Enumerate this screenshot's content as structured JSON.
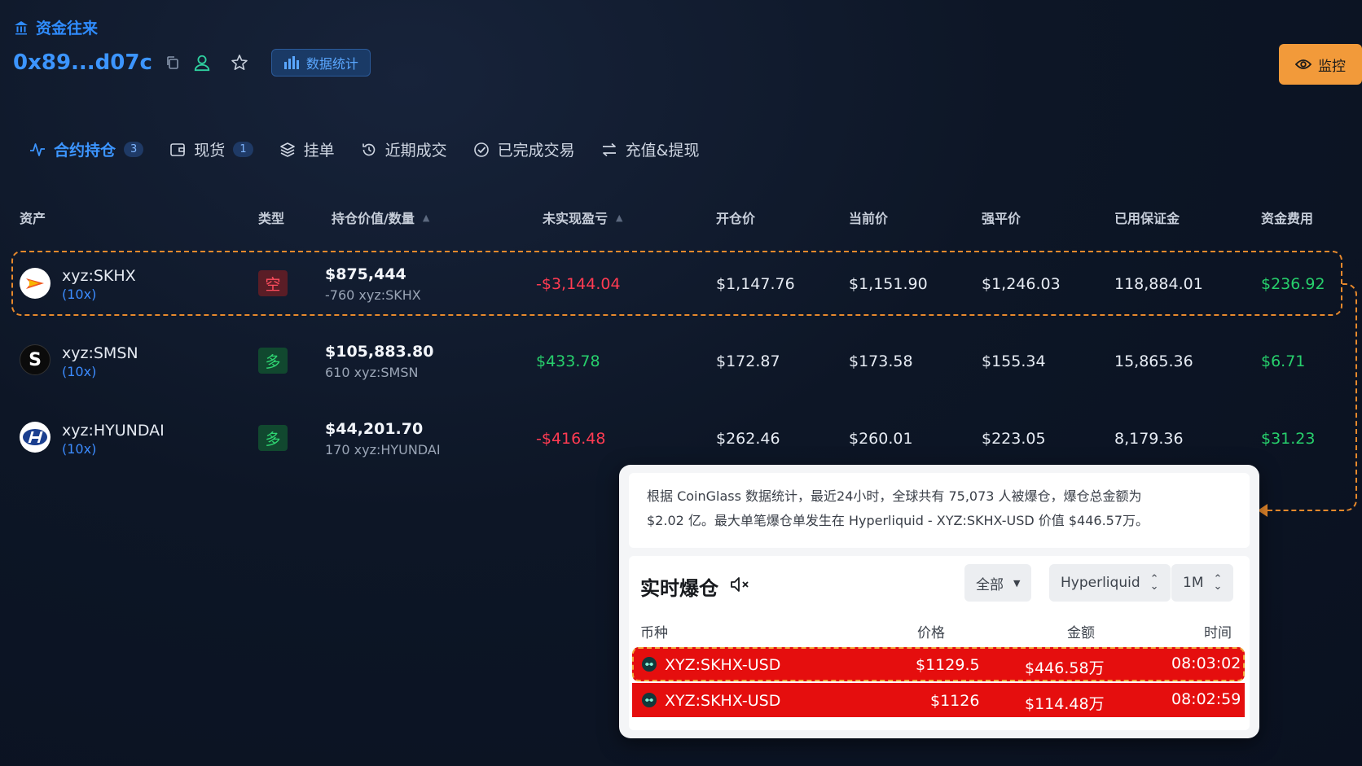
{
  "header": {
    "section_title": "资金往来",
    "address": "0x89...d07c",
    "stats_button": "数据统计",
    "monitor_button": "监控"
  },
  "tabs": [
    {
      "label": "合约持仓",
      "badge": "3",
      "active": true,
      "icon": "activity-icon"
    },
    {
      "label": "现货",
      "badge": "1",
      "icon": "wallet-icon"
    },
    {
      "label": "挂单",
      "icon": "layers-icon"
    },
    {
      "label": "近期成交",
      "icon": "history-icon"
    },
    {
      "label": "已完成交易",
      "icon": "check-circle-icon"
    },
    {
      "label": "充值&提现",
      "icon": "transfer-icon"
    }
  ],
  "table": {
    "columns": [
      "资产",
      "类型",
      "持仓价值/数量",
      "未实现盈亏",
      "开仓价",
      "当前价",
      "强平价",
      "已用保证金",
      "资金费用"
    ],
    "rows": [
      {
        "asset": "xyz:SKHX",
        "leverage": "(10x)",
        "type": "空",
        "value": "$875,444",
        "qty": "-760 xyz:SKHX",
        "pnl": "-$3,144.04",
        "entry": "$1,147.76",
        "current": "$1,151.90",
        "liq": "$1,246.03",
        "margin": "118,884.01",
        "funding": "$236.92"
      },
      {
        "asset": "xyz:SMSN",
        "leverage": "(10x)",
        "type": "多",
        "value": "$105,883.80",
        "qty": "610 xyz:SMSN",
        "pnl": "$433.78",
        "entry": "$172.87",
        "current": "$173.58",
        "liq": "$155.34",
        "margin": "15,865.36",
        "funding": "$6.71"
      },
      {
        "asset": "xyz:HYUNDAI",
        "leverage": "(10x)",
        "type": "多",
        "value": "$44,201.70",
        "qty": "170 xyz:HYUNDAI",
        "pnl": "-$416.48",
        "entry": "$262.46",
        "current": "$260.01",
        "liq": "$223.05",
        "margin": "8,179.36",
        "funding": "$31.23"
      }
    ]
  },
  "popup": {
    "summary_line1": "根据 CoinGlass 数据统计，最近24小时，全球共有 75,073 人被爆仓，爆仓总金额为",
    "summary_line2": "$2.02 亿。最大单笔爆仓单发生在 Hyperliquid - XYZ:SKHX-USD 价值 $446.57万。",
    "title": "实时爆仓",
    "filter_all": "全部",
    "filter_exchange": "Hyperliquid",
    "filter_period": "1M",
    "columns": [
      "币种",
      "价格",
      "金额",
      "时间"
    ],
    "rows": [
      {
        "symbol": "XYZ:SKHX-USD",
        "price": "$1129.5",
        "amount": "$446.58万",
        "time": "08:03:02"
      },
      {
        "symbol": "XYZ:SKHX-USD",
        "price": "$1126",
        "amount": "$114.48万",
        "time": "08:02:59"
      }
    ]
  },
  "colors": {
    "accent": "#3c95ff",
    "loss": "#ff3b52",
    "gain": "#27d06c",
    "highlight": "#e7892c",
    "liquidation": "#e50e0e"
  }
}
